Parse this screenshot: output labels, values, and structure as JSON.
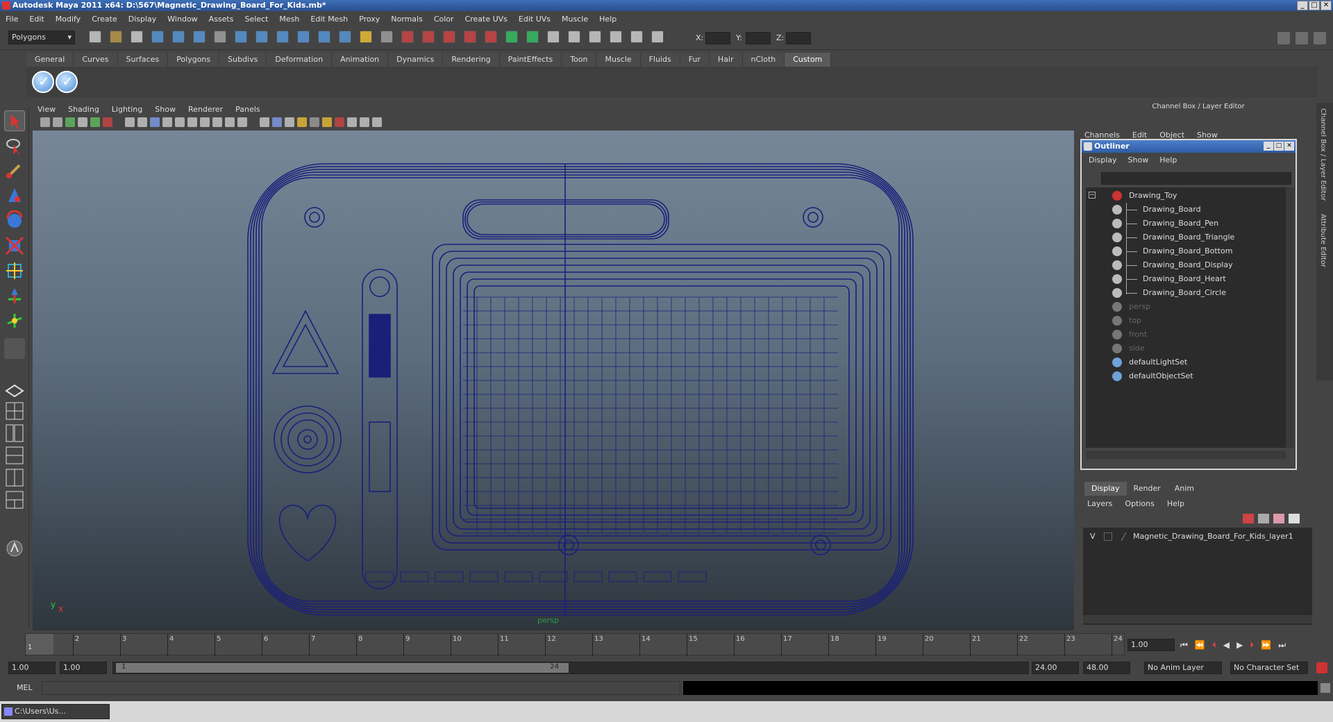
{
  "window": {
    "title": "Autodesk Maya 2011 x64: D:\\567\\Magnetic_Drawing_Board_For_Kids.mb*",
    "controls": [
      "_",
      "□",
      "✕"
    ]
  },
  "menubar": [
    "File",
    "Edit",
    "Modify",
    "Create",
    "Display",
    "Window",
    "Assets",
    "Select",
    "Mesh",
    "Edit Mesh",
    "Proxy",
    "Normals",
    "Color",
    "Create UVs",
    "Edit UVs",
    "Muscle",
    "Help"
  ],
  "status": {
    "mode": "Polygons",
    "x_label": "X:",
    "y_label": "Y:",
    "z_label": "Z:"
  },
  "shelf": {
    "tabs": [
      "General",
      "Curves",
      "Surfaces",
      "Polygons",
      "Subdivs",
      "Deformation",
      "Animation",
      "Dynamics",
      "Rendering",
      "PaintEffects",
      "Toon",
      "Muscle",
      "Fluids",
      "Fur",
      "Hair",
      "nCloth",
      "Custom"
    ],
    "active": "Custom"
  },
  "panel": {
    "menu": [
      "View",
      "Shading",
      "Lighting",
      "Show",
      "Renderer",
      "Panels"
    ],
    "camera_label": "persp",
    "axis_y": "y",
    "axis_x": "x"
  },
  "channelbox": {
    "header": "Channel Box / Layer Editor",
    "menu": [
      "Channels",
      "Edit",
      "Object",
      "Show"
    ]
  },
  "sidetabs": [
    "Channel Box / Layer Editor",
    "Attribute Editor"
  ],
  "outliner": {
    "title": "Outliner",
    "menu": [
      "Display",
      "Show",
      "Help"
    ],
    "items": [
      {
        "label": "Drawing_Toy",
        "depth": 0,
        "dim": false
      },
      {
        "label": "Drawing_Board",
        "depth": 1,
        "dim": false
      },
      {
        "label": "Drawing_Board_Pen",
        "depth": 1,
        "dim": false
      },
      {
        "label": "Drawing_Board_Triangle",
        "depth": 1,
        "dim": false
      },
      {
        "label": "Drawing_Board_Bottom",
        "depth": 1,
        "dim": false
      },
      {
        "label": "Drawing_Board_Display",
        "depth": 1,
        "dim": false
      },
      {
        "label": "Drawing_Board_Heart",
        "depth": 1,
        "dim": false
      },
      {
        "label": "Drawing_Board_Circle",
        "depth": 1,
        "dim": false
      },
      {
        "label": "persp",
        "depth": 0,
        "dim": true
      },
      {
        "label": "top",
        "depth": 0,
        "dim": true
      },
      {
        "label": "front",
        "depth": 0,
        "dim": true
      },
      {
        "label": "side",
        "depth": 0,
        "dim": true
      },
      {
        "label": "defaultLightSet",
        "depth": 0,
        "dim": false
      },
      {
        "label": "defaultObjectSet",
        "depth": 0,
        "dim": false
      }
    ]
  },
  "layers": {
    "tabs": [
      "Display",
      "Render",
      "Anim"
    ],
    "active": "Display",
    "menu": [
      "Layers",
      "Options",
      "Help"
    ],
    "row": {
      "visible": "V",
      "name": "Magnetic_Drawing_Board_For_Kids_layer1"
    }
  },
  "time": {
    "ticks": [
      "1",
      "2",
      "3",
      "4",
      "5",
      "6",
      "7",
      "8",
      "9",
      "10",
      "11",
      "12",
      "13",
      "14",
      "15",
      "16",
      "17",
      "18",
      "19",
      "20",
      "21",
      "22",
      "23",
      "24"
    ],
    "current": "1.00",
    "current_frame": "1"
  },
  "range": {
    "start": "1.00",
    "start2": "1.00",
    "slider_start": "1",
    "slider_end": "24",
    "end": "24.00",
    "end2": "48.00",
    "anim_layer": "No Anim Layer",
    "char_set": "No Character Set"
  },
  "cmd": {
    "label": "MEL"
  },
  "taskbar": {
    "label": "C:\\Users\\Us..."
  }
}
